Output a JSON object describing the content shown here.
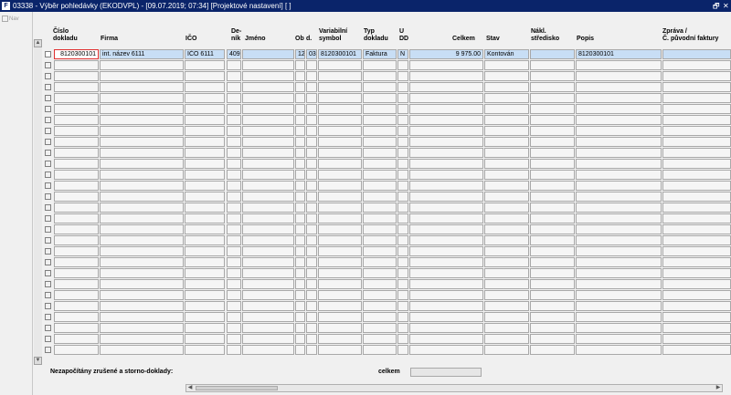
{
  "window": {
    "title": "03338 - Výběr pohledávky (EKODVPL) - [09.07.2019; 07:34]  [Projektové nastavení]  [ ]",
    "app_icon_glyph": "F",
    "restore_glyph": "🗗",
    "close_glyph": "✕"
  },
  "left_panel": {
    "nav_label": "Nav"
  },
  "columns": [
    {
      "key": "cislo",
      "label": "Číslo\ndokladu"
    },
    {
      "key": "firma",
      "label": "Firma"
    },
    {
      "key": "ico",
      "label": "IČO"
    },
    {
      "key": "denik",
      "label": "De-\nník"
    },
    {
      "key": "jmeno",
      "label": "Jméno"
    },
    {
      "key": "ob",
      "label": "Ob"
    },
    {
      "key": "d",
      "label": "d."
    },
    {
      "key": "vs",
      "label": "Variabilní\nsymbol"
    },
    {
      "key": "typ",
      "label": "Typ\ndokladu"
    },
    {
      "key": "udd",
      "label": "U\nDD"
    },
    {
      "key": "celkem",
      "label": "Celkem"
    },
    {
      "key": "stav",
      "label": "Stav"
    },
    {
      "key": "stred",
      "label": "Nákl.\nstředisko"
    },
    {
      "key": "popis",
      "label": "Popis"
    },
    {
      "key": "zprava",
      "label": "Zpráva /\nČ. původní faktury"
    }
  ],
  "rows": [
    {
      "cislo": "8120300101",
      "firma": "int. název 6111",
      "ico": "IČO 6111",
      "denik": "409",
      "jmeno": "",
      "ob": "12",
      "d": "03",
      "vs": "8120300101",
      "typ": "Faktura",
      "udd": "N",
      "celkem": "9 975.00",
      "stav": "Kontován",
      "stred": "",
      "popis": "8120300101",
      "zprava": ""
    }
  ],
  "footer": {
    "cancelled_label": "Nezapočítány zrušené a storno-doklady:",
    "total_label": "celkem",
    "total_value": ""
  },
  "scroll": {
    "up": "▲",
    "down": "▼",
    "left": "◀",
    "right": "▶"
  },
  "colors": {
    "titlebar": "#0a246a",
    "selected_row": "#c8def5",
    "focus_border": "#e03030"
  }
}
